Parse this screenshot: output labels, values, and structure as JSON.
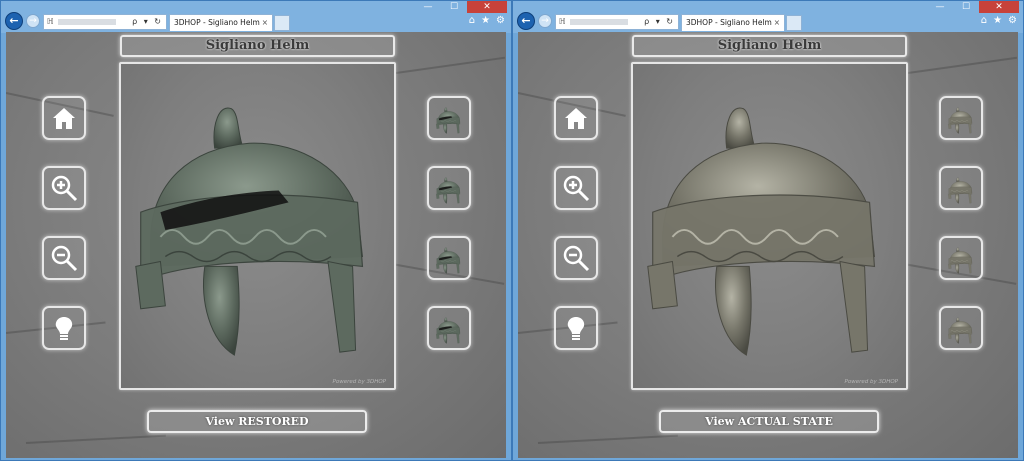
{
  "browser": {
    "window_controls": {
      "minimize": "—",
      "maximize": "☐",
      "close": "✕"
    },
    "back_glyph": "←",
    "forward_glyph": "→",
    "address_prefix": "ℍ",
    "address_tools": "ρ ▾ ↻",
    "tab_title": "3DHOP - Sigliano Helm",
    "tab_close": "×",
    "toolbar_icons": {
      "home": "⌂",
      "favorites": "★",
      "settings": "⚙"
    }
  },
  "panels": [
    {
      "title": "Sigliano Helm",
      "toggle_label": "View RESTORED",
      "powered_by": "Powered by 3DHOP",
      "model_tint": "#5d6a5f",
      "model_shade": "#3b443d",
      "model_highlight": "#8b998c",
      "variant": "restored-damaged"
    },
    {
      "title": "Sigliano Helm",
      "toggle_label": "View ACTUAL STATE",
      "powered_by": "Powered by 3DHOP",
      "model_tint": "#77766a",
      "model_shade": "#4a4a42",
      "model_highlight": "#b4b3a5",
      "variant": "restored-complete"
    }
  ],
  "toolbar": [
    "home-icon",
    "zoom-in-icon",
    "zoom-out-icon",
    "light-icon"
  ],
  "view_presets": [
    "view-front",
    "view-side",
    "view-top",
    "view-back"
  ]
}
